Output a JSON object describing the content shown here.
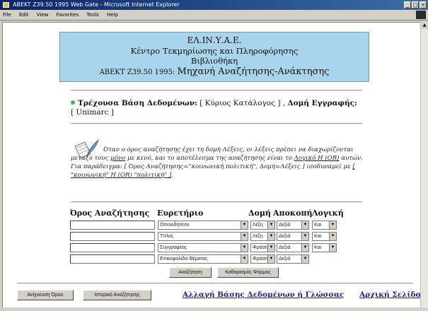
{
  "window": {
    "title": "ABEKT Z39.50 1995 Web Gate - Microsoft Internet Explorer",
    "menu": [
      "File",
      "Edit",
      "View",
      "Favorites",
      "Tools",
      "Help"
    ]
  },
  "header": {
    "line1": "ΕΛ.ΙΝ.Υ.Α.Ε.",
    "line2": "Κέντρο Τεκμηρίωσης και Πληροφόρησης",
    "line3": "Βιβλιοθήκη",
    "line4_prefix": "ΑΒΕΚΤ Z39.50 1995:",
    "line4_title": "Μηχανή Αναζήτησης-Ανάκτησης"
  },
  "database": {
    "current_label": "Τρέχουσα Βάση Δεδομένων:",
    "current_value": "[ Κύριος Κατάλογος ] ,",
    "record_label": "Δομή Εγγραφής:",
    "record_value": "[ Unimarc ]"
  },
  "help": {
    "text1": "Όταν ο όρος αναζήτησης έχει τη δομή Λέξεις, οι λέξεις πρέπει να διαχωρίζονται μεταξύ τους ",
    "only": "μόνο",
    "text2": " με κενό, και το αποτέλεσμα της αναζήτησης είναι το ",
    "logic": "Λογικό Η (OR)",
    "text3": " αυτών. Για παράδειγμα: [ Όρος Αναζήτησης=\"κοινωνική πολιτική\", Δομή=Λέξεις ] ισοδυναμεί με ",
    "example": "[ \"κοινωνική\" Η (OR) \"πολιτική\" ]",
    "text4": "."
  },
  "columns": {
    "term": "Όρος Αναζήτησης",
    "index": "Ευρετήριο",
    "structure": "Δομή",
    "truncation": "Αποκοπή",
    "logic": "Λογική"
  },
  "rows": [
    {
      "term": "",
      "index": "Οποιοδήποτε",
      "structure": "Λέξη",
      "truncation": "Δεξιά",
      "logic": "Και"
    },
    {
      "term": "",
      "index": "Τίτλος",
      "structure": "Λέξη",
      "truncation": "Δεξιά",
      "logic": "Και"
    },
    {
      "term": "",
      "index": "Συγγραφέας",
      "structure": "Φράση",
      "truncation": "Δεξιά",
      "logic": "Και"
    },
    {
      "term": "",
      "index": "Επικεφαλίδα Θέματος",
      "structure": "Φράση",
      "truncation": "Δεξιά",
      "logic": ""
    }
  ],
  "buttons": {
    "search": "Αναζήτηση",
    "clear": "Καθαρισμός Φόρμας",
    "browse": "Ανίχνευση Όρου",
    "history": "Ιστορικό Αναζήτησης"
  },
  "links": {
    "change_db": "Αλλαγή Βάσης Δεδομένων ή Γλώσσας",
    "home": "Αρχική Σελίδα"
  }
}
